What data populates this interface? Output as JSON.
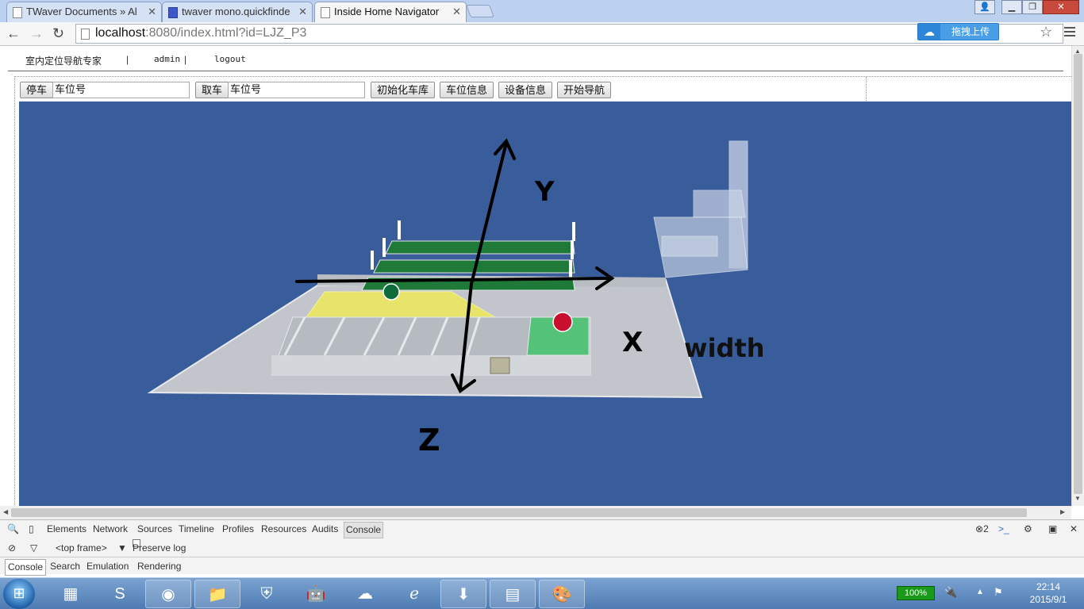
{
  "browser": {
    "tabs": [
      {
        "title": "TWaver Documents » Al",
        "active": false
      },
      {
        "title": "twaver mono.quickfinde",
        "active": false
      },
      {
        "title": "Inside Home Navigator",
        "active": true
      }
    ],
    "url_host": "localhost",
    "url_rest": ":8080/index.html?id=LJZ_P3",
    "upload_label": "拖拽上传"
  },
  "app": {
    "brand": "室内定位导航专家",
    "user": "admin",
    "logout": "logout",
    "controls": {
      "park_label": "停车",
      "park_value": "车位号",
      "pickup_label": "取车",
      "pickup_value": "车位号",
      "init_garage": "初始化车库",
      "space_info": "车位信息",
      "device_info": "设备信息",
      "start_nav": "开始导航"
    }
  },
  "scene": {
    "background": "#395d9a",
    "axis_labels": {
      "x": "X",
      "y": "Y",
      "z": "Z"
    },
    "dimension_label": "width"
  },
  "devtools": {
    "tabs": [
      "Elements",
      "Network",
      "Sources",
      "Timeline",
      "Profiles",
      "Resources",
      "Audits",
      "Console"
    ],
    "active_tab": "Console",
    "error_count": "2",
    "frame": "<top frame>",
    "preserve_log": "Preserve log",
    "drawer_tabs": [
      "Console",
      "Search",
      "Emulation",
      "Rendering"
    ]
  },
  "taskbar": {
    "battery": "100%",
    "time": "22:14",
    "date": "2015/9/1"
  }
}
